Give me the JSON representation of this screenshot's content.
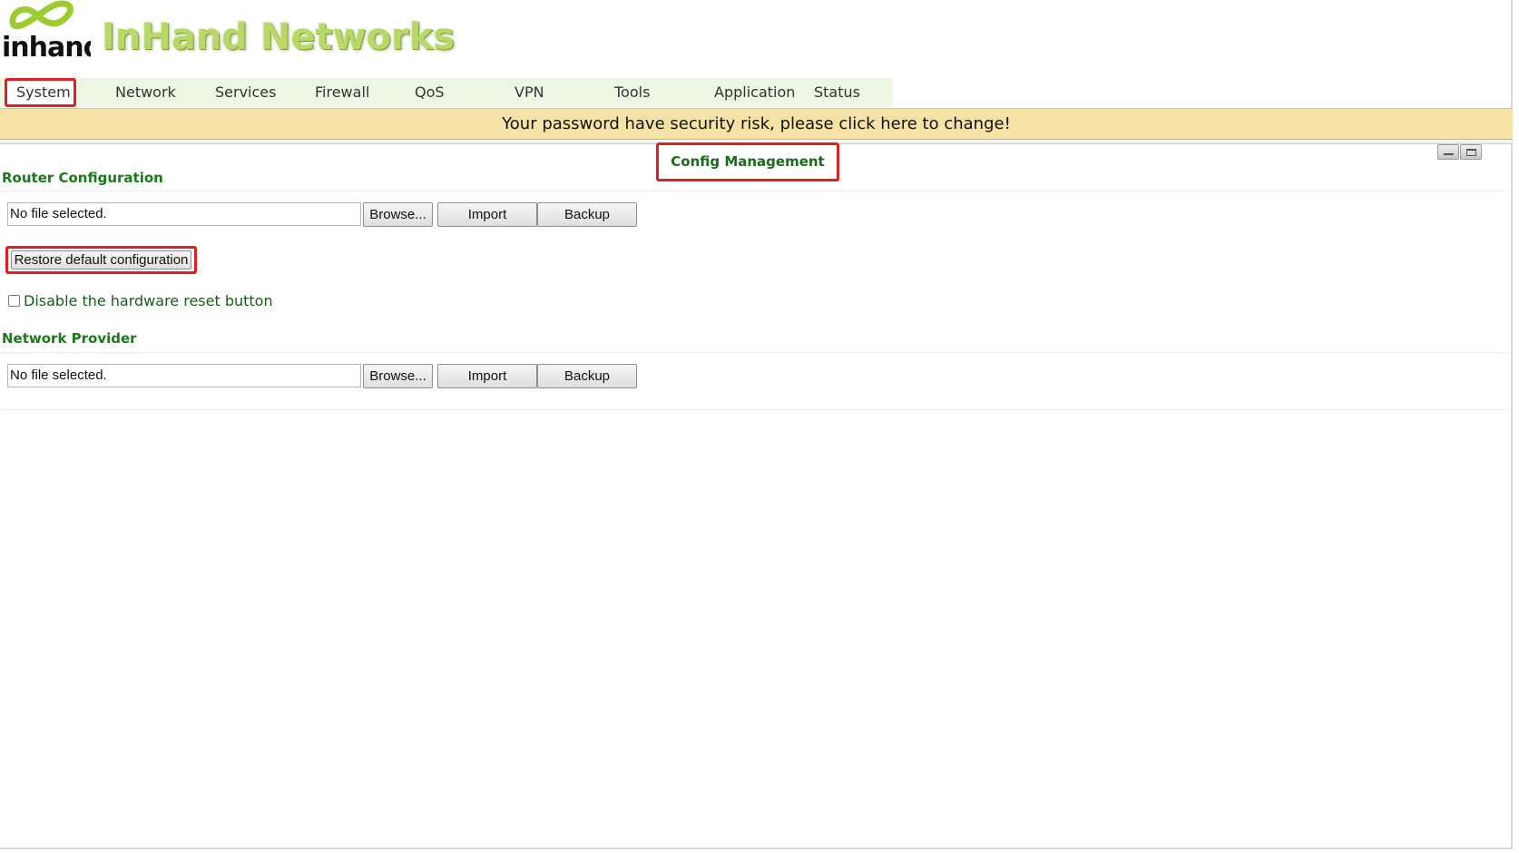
{
  "header": {
    "logo_text": "inhand",
    "brand_title": "InHand Networks"
  },
  "nav": {
    "items": [
      {
        "label": "System",
        "active": true
      },
      {
        "label": "Network"
      },
      {
        "label": "Services"
      },
      {
        "label": "Firewall"
      },
      {
        "label": "QoS"
      },
      {
        "label": "VPN"
      },
      {
        "label": "Tools"
      },
      {
        "label": "Application"
      },
      {
        "label": "Status"
      }
    ]
  },
  "banner": {
    "text": "Your password have security risk, please click here to change!"
  },
  "page": {
    "title": "Config Management"
  },
  "router_config": {
    "title": "Router Configuration",
    "file_value": "No file selected.",
    "browse_label": "Browse...",
    "import_label": "Import",
    "backup_label": "Backup",
    "restore_label": "Restore default configuration",
    "disable_reset_label": "Disable the hardware reset button",
    "disable_reset_checked": false
  },
  "network_provider": {
    "title": "Network Provider",
    "file_value": "No file selected.",
    "browse_label": "Browse...",
    "import_label": "Import",
    "backup_label": "Backup"
  },
  "colors": {
    "brand_green": "#b9d86a",
    "section_green": "#1a7a1a",
    "banner_bg": "#f4e3a4",
    "highlight_red": "#e02020"
  },
  "icons": {
    "logo": "inhand-logo-icon",
    "minimize": "minimize-icon",
    "maximize": "maximize-icon"
  }
}
